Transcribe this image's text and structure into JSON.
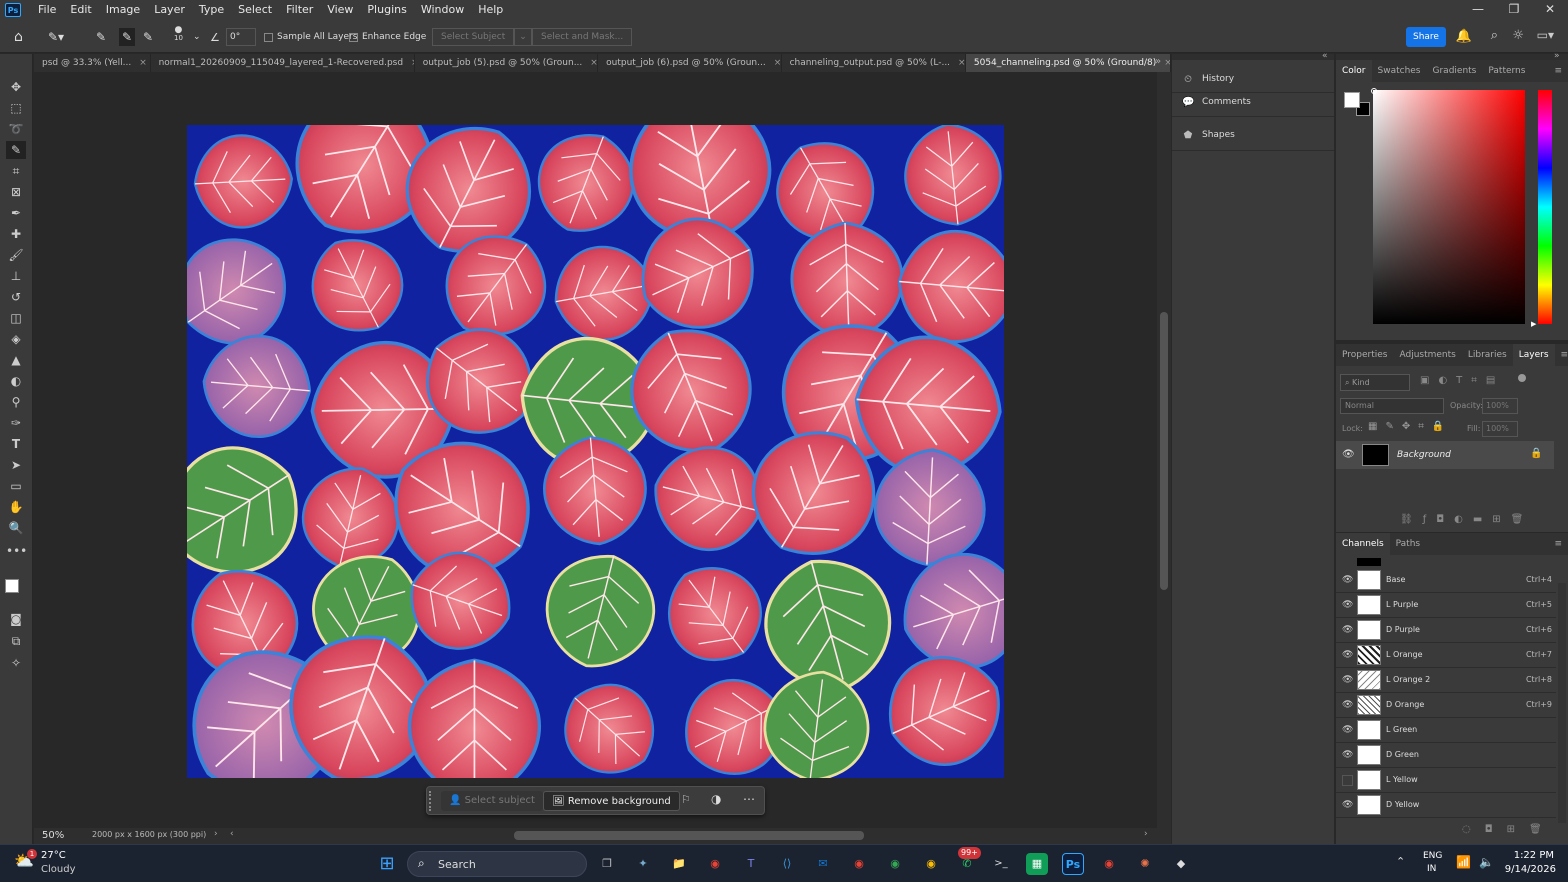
{
  "app": {
    "logo_text": "Ps"
  },
  "menu": [
    "File",
    "Edit",
    "Image",
    "Layer",
    "Type",
    "Select",
    "Filter",
    "View",
    "Plugins",
    "Window",
    "Help"
  ],
  "window_controls": {
    "minimize": "—",
    "restore": "❐",
    "close": "✕"
  },
  "options": {
    "brush_size": "10",
    "angle": "0°",
    "sample_all_layers": "Sample All Layers",
    "enhance_edge": "Enhance Edge",
    "select_subject": "Select Subject",
    "select_and_mask": "Select and Mask...",
    "share": "Share"
  },
  "tabs": [
    {
      "label": "psd @ 33.3% (Yell...",
      "active": false
    },
    {
      "label": "normal1_20260909_115049_layered_1-Recovered.psd",
      "active": false
    },
    {
      "label": "output_job (5).psd @ 50% (Groun...",
      "active": false
    },
    {
      "label": "output_job (6).psd @ 50% (Groun...",
      "active": false
    },
    {
      "label": "channeling_output.psd @ 50% (L-...",
      "active": false
    },
    {
      "label": "5054_channeling.psd @ 50% (Ground/8)",
      "active": true
    }
  ],
  "tab_close": "×",
  "status": {
    "zoom": "50%",
    "doc_info": "2000 px x 1600 px (300 ppi)"
  },
  "context_bar": {
    "select_subject": "Select subject",
    "remove_background": "Remove background"
  },
  "mini_panels": [
    "History",
    "Comments",
    "Shapes"
  ],
  "color_panel": {
    "tabs": [
      "Color",
      "Swatches",
      "Gradients",
      "Patterns"
    ],
    "active": "Color",
    "foreground": "#ffffff",
    "background": "#000000"
  },
  "layers_panel": {
    "tabs": [
      "Properties",
      "Adjustments",
      "Libraries",
      "Layers"
    ],
    "active": "Layers",
    "filter_placeholder": "Kind",
    "blend_mode": "Normal",
    "opacity_label": "Opacity:",
    "opacity_value": "100%",
    "lock_label": "Lock:",
    "fill_label": "Fill:",
    "fill_value": "100%",
    "layers": [
      {
        "name": "Background",
        "visible": true,
        "locked": true
      }
    ]
  },
  "channels_panel": {
    "tabs": [
      "Channels",
      "Paths"
    ],
    "active": "Channels",
    "channels": [
      {
        "name": "Base",
        "shortcut": "Ctrl+4",
        "visible": true
      },
      {
        "name": "L Purple",
        "shortcut": "Ctrl+5",
        "visible": true
      },
      {
        "name": "D Purple",
        "shortcut": "Ctrl+6",
        "visible": true
      },
      {
        "name": "L Orange",
        "shortcut": "Ctrl+7",
        "visible": true
      },
      {
        "name": "L Orange 2",
        "shortcut": "Ctrl+8",
        "visible": true
      },
      {
        "name": "D Orange",
        "shortcut": "Ctrl+9",
        "visible": true
      },
      {
        "name": "L Green",
        "shortcut": "",
        "visible": true
      },
      {
        "name": "D Green",
        "shortcut": "",
        "visible": true
      },
      {
        "name": "L Yellow",
        "shortcut": "",
        "visible": false
      },
      {
        "name": "D Yellow",
        "shortcut": "",
        "visible": true
      }
    ]
  },
  "taskbar": {
    "weather_temp": "27°C",
    "weather_desc": "Cloudy",
    "weather_badge": "1",
    "search": "Search",
    "notif_badge": "99+",
    "lang_top": "ENG",
    "lang_bottom": "IN",
    "time": "1:22 PM",
    "date": "9/14/2026"
  },
  "colors": {
    "accent": "#1473e6",
    "canvas_bg": "#1122a0",
    "leaf_red": "#e05a6a",
    "leaf_green": "#4f9a4a",
    "leaf_blue": "#3b82d8"
  }
}
